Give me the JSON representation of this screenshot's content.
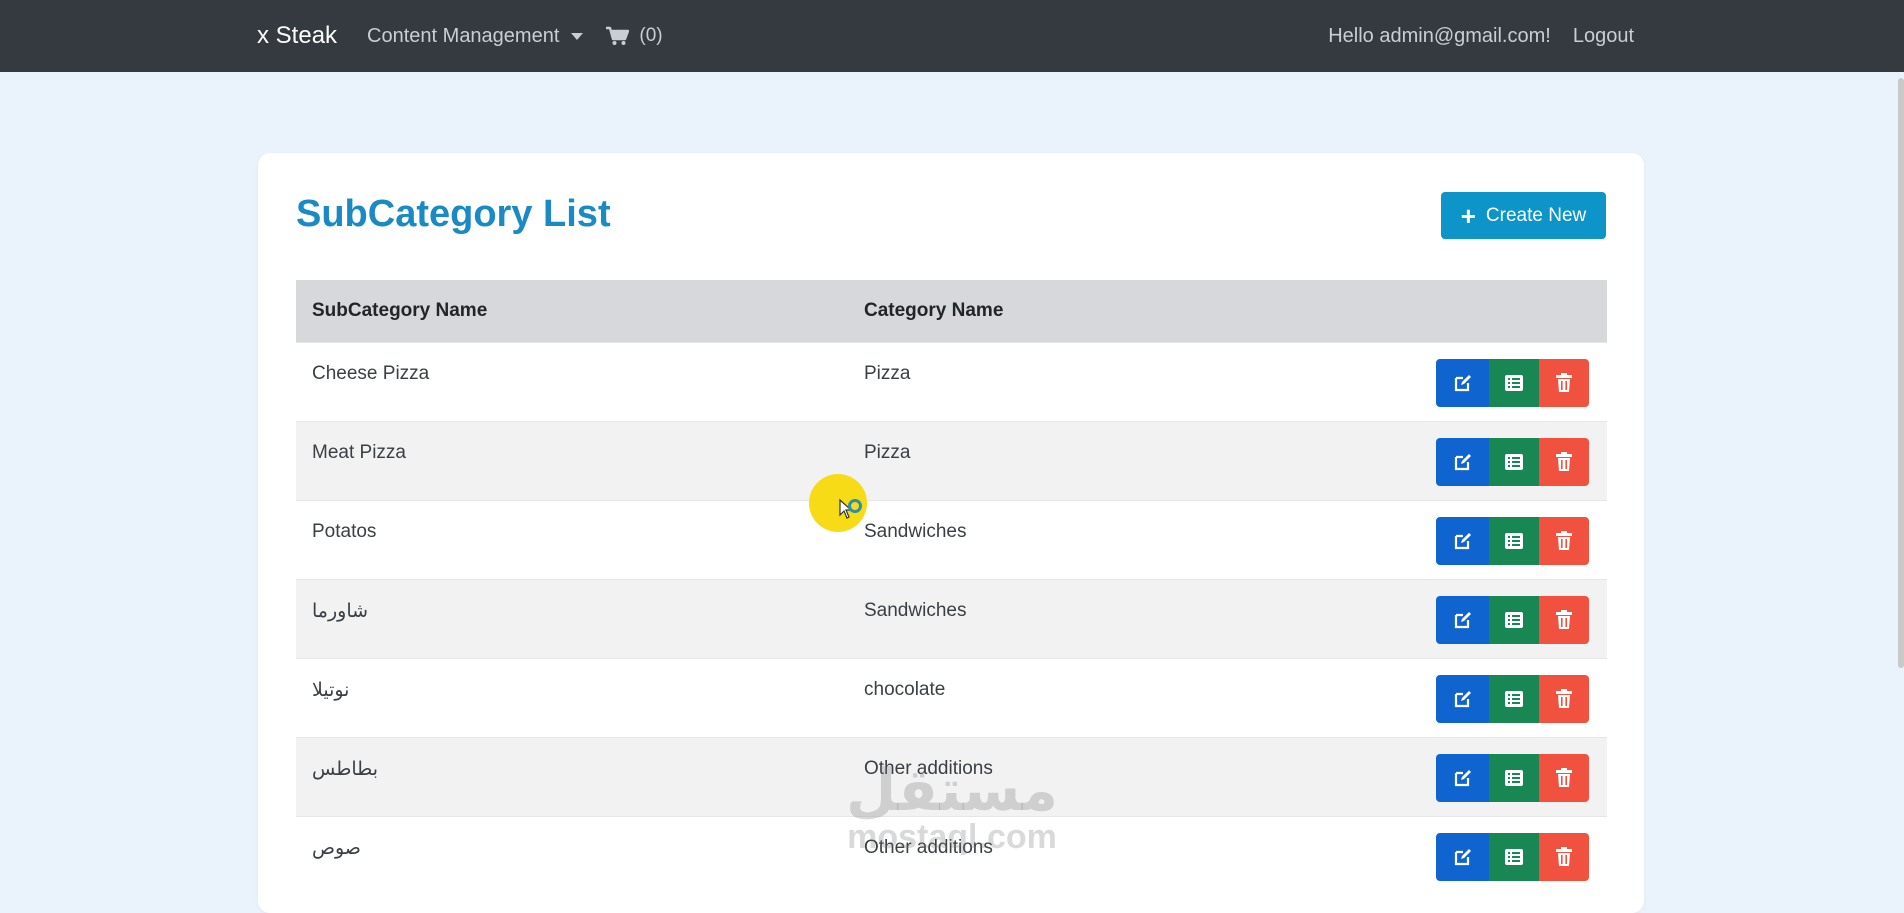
{
  "navbar": {
    "brand": "x Steak",
    "content_management": "Content Management",
    "cart_count": "(0)",
    "greeting": "Hello admin@gmail.com!",
    "logout": "Logout"
  },
  "page": {
    "title": "SubCategory List",
    "create_button": "Create New"
  },
  "table": {
    "headers": {
      "subcategory": "SubCategory Name",
      "category": "Category Name"
    },
    "rows": [
      {
        "subcategory": "Cheese Pizza",
        "category": "Pizza"
      },
      {
        "subcategory": "Meat Pizza",
        "category": "Pizza"
      },
      {
        "subcategory": "Potatos",
        "category": "Sandwiches"
      },
      {
        "subcategory": "شاورما",
        "category": "Sandwiches"
      },
      {
        "subcategory": "نوتيلا",
        "category": "chocolate"
      },
      {
        "subcategory": "بطاطس",
        "category": "Other additions"
      },
      {
        "subcategory": "صوص",
        "category": "Other additions"
      }
    ]
  },
  "watermark": {
    "arabic": "مستقل",
    "latin": "mostaql.com"
  },
  "icons": {
    "cart": "cart-icon",
    "plus": "plus-icon",
    "edit": "edit-icon",
    "details": "list-icon",
    "delete": "trash-icon"
  },
  "colors": {
    "navbar": "#343a40",
    "title": "#1a8ac4",
    "create_button": "#0d94c9",
    "edit_button": "#1064d0",
    "details_button": "#198754",
    "delete_button": "#f0523f",
    "header_row": "#d6d8db"
  }
}
